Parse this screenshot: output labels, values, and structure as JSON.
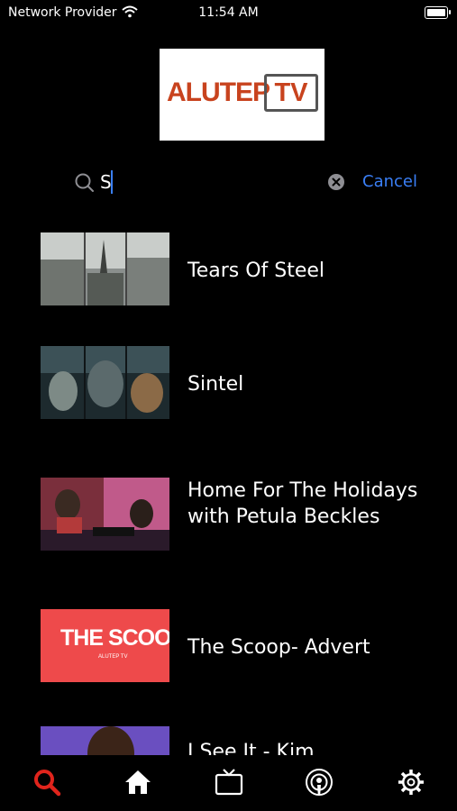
{
  "status_bar": {
    "carrier": "Network Provider",
    "time": "11:54 AM"
  },
  "logo": {
    "word": "ALUTEP",
    "badge": "TV"
  },
  "search": {
    "query": "S",
    "cancel_label": "Cancel"
  },
  "results": [
    {
      "title": "Tears Of Steel"
    },
    {
      "title": "Sintel"
    },
    {
      "title": "Home For The Holidays with Petula Beckles"
    },
    {
      "title": "The Scoop- Advert",
      "thumb_text": "THE SCOO",
      "thumb_brand": "ALUTEP TV"
    },
    {
      "title": "I See It - Kim"
    }
  ],
  "tabbar": {
    "active_color": "#e0241c",
    "tabs": [
      {
        "icon": "search-icon",
        "active": true
      },
      {
        "icon": "home-icon",
        "active": false
      },
      {
        "icon": "tv-icon",
        "active": false
      },
      {
        "icon": "podcast-icon",
        "active": false
      },
      {
        "icon": "gear-icon",
        "active": false
      }
    ]
  },
  "colors": {
    "accent": "#3a7ff6",
    "brand": "#c8431e",
    "background": "#000000"
  }
}
